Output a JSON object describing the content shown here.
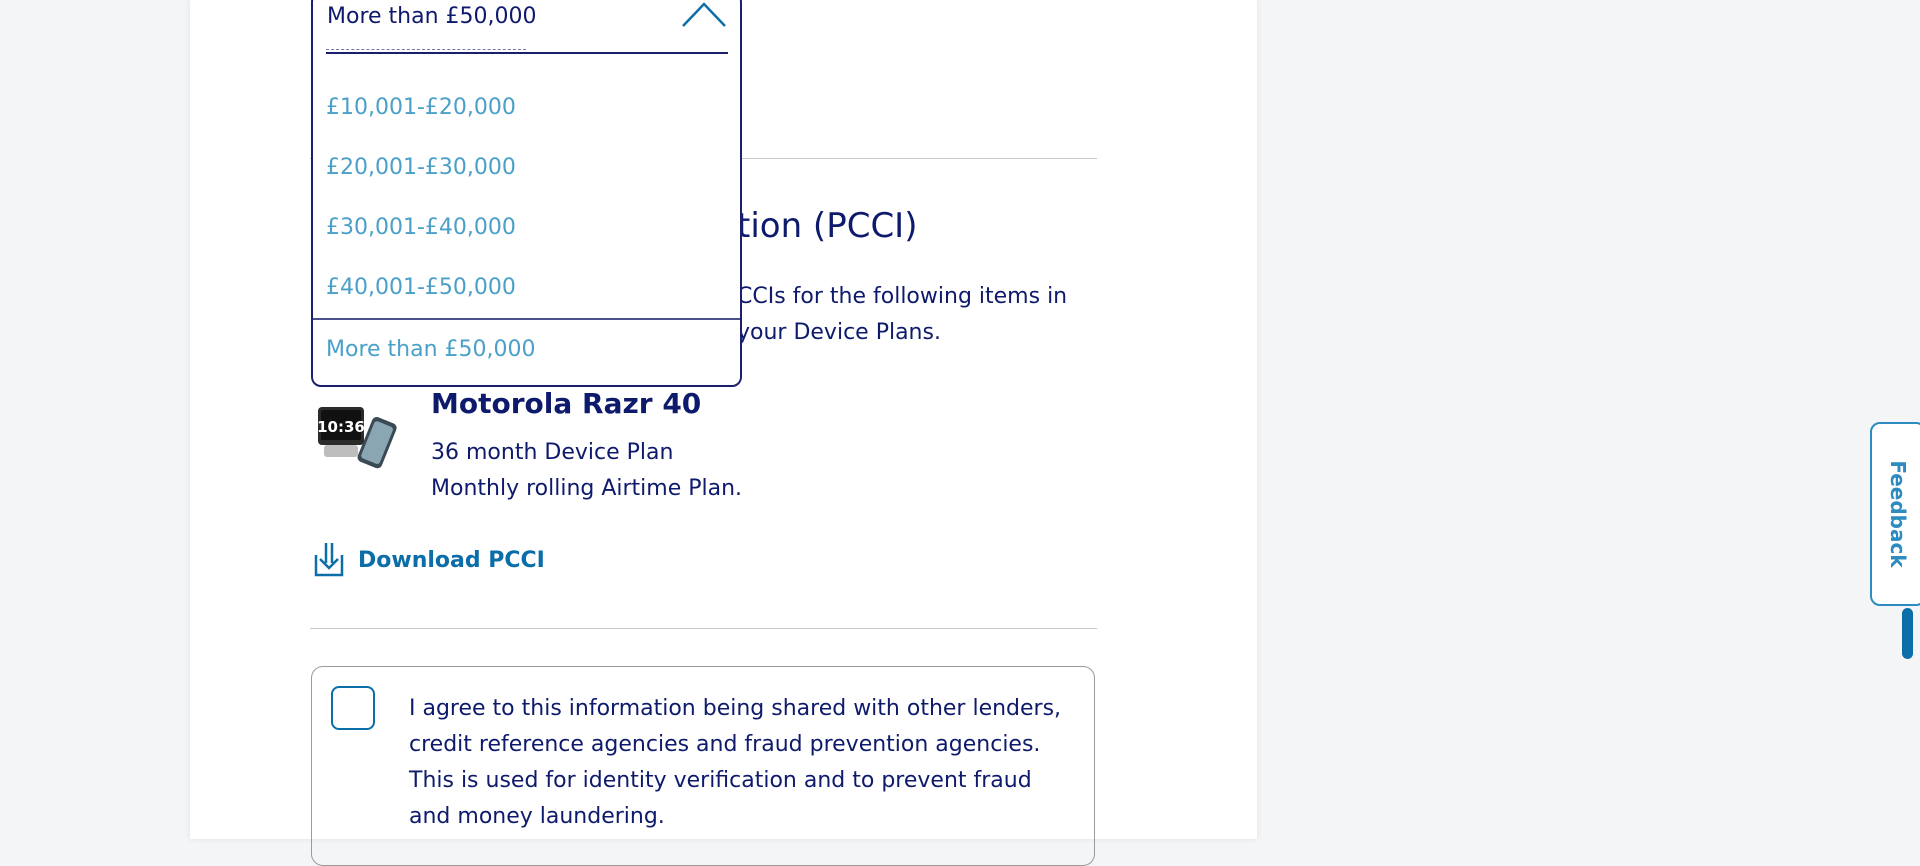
{
  "income_dropdown": {
    "selected_value": "More than £50,000",
    "options": [
      "£10,001-£20,000",
      "£20,001-£30,000",
      "£30,001-£40,000",
      "£40,001-£50,000",
      "More than £50,000"
    ]
  },
  "pcci": {
    "heading_visible": "tion (PCCI)",
    "description_visible_line1": "CCIs for the following items in",
    "description_visible_line2": "your Device Plans.",
    "device": {
      "name": "Motorola Razr 40",
      "plan_line1": "36 month Device Plan",
      "plan_line2": "Monthly rolling Airtime Plan.",
      "image_icon": "phone-bundle-image"
    },
    "download_label": "Download PCCI",
    "download_icon": "download-icon"
  },
  "consent": {
    "text": "I agree to this information being shared with other lenders, credit reference agencies and fraud prevention agencies. This is used for identity verification and to prevent fraud and money laundering.",
    "checked": false
  },
  "feedback": {
    "label": "Feedback"
  },
  "colors": {
    "navy_text": "#0e1a6b",
    "link_blue": "#0b6ea8",
    "option_blue": "#4aa0c8",
    "feedback_blue": "#2d8bbf",
    "page_bg": "#f4f5f6"
  }
}
